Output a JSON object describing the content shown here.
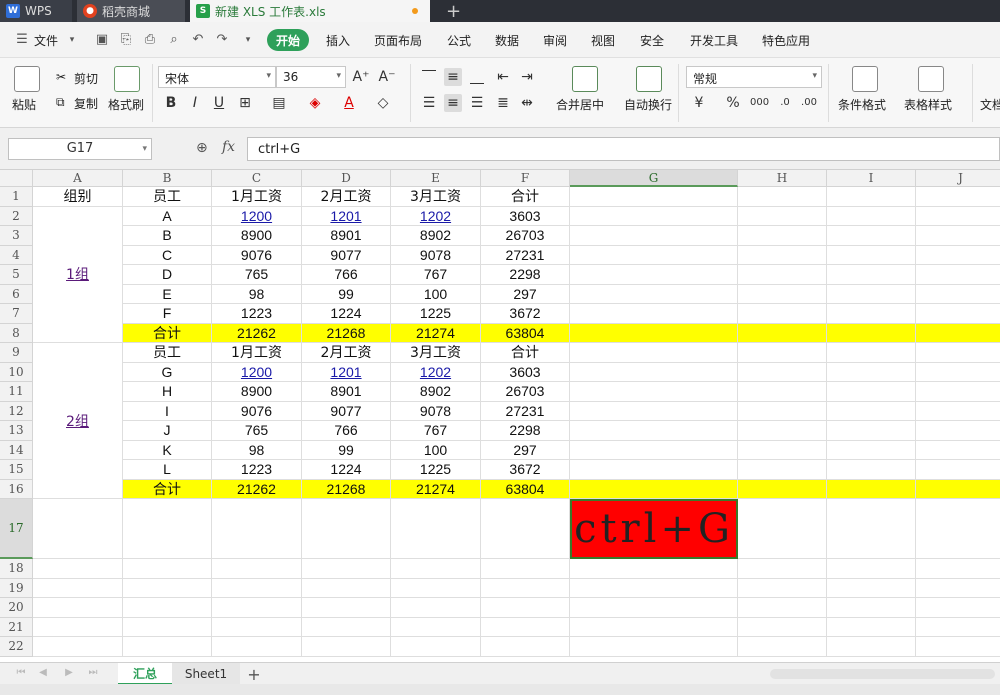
{
  "tabs": {
    "wps": "WPS",
    "daoke": "稻壳商城",
    "file": "新建 XLS 工作表.xls",
    "new": "+"
  },
  "menu": {
    "file": "文件",
    "start": "开始",
    "items": [
      "插入",
      "页面布局",
      "公式",
      "数据",
      "审阅",
      "视图",
      "安全",
      "开发工具",
      "特色应用"
    ]
  },
  "ribbon": {
    "paste": "粘贴",
    "cut": "剪切",
    "copy": "复制",
    "format_painter": "格式刷",
    "font": "宋体",
    "size": "36",
    "merge": "合并居中",
    "wrap": "自动换行",
    "numfmt": "常规",
    "cond": "条件格式",
    "tablestyle": "表格样式",
    "doc": "文档"
  },
  "formula": {
    "namebox": "G17",
    "fx": "fx",
    "value": "ctrl+G"
  },
  "columns": [
    "A",
    "B",
    "C",
    "D",
    "E",
    "F",
    "G",
    "H",
    "I",
    "J"
  ],
  "rows": [
    "1",
    "2",
    "3",
    "4",
    "5",
    "6",
    "7",
    "8",
    "9",
    "10",
    "11",
    "12",
    "13",
    "14",
    "15",
    "16",
    "17",
    "18",
    "19",
    "20",
    "21",
    "22"
  ],
  "table1": {
    "group_header": "组别",
    "headers": [
      "员工",
      "1月工资",
      "2月工资",
      "3月工资",
      "合计"
    ],
    "group": "1组",
    "rows": [
      [
        "A",
        "1200",
        "1201",
        "1202",
        "3603"
      ],
      [
        "B",
        "8900",
        "8901",
        "8902",
        "26703"
      ],
      [
        "C",
        "9076",
        "9077",
        "9078",
        "27231"
      ],
      [
        "D",
        "765",
        "766",
        "767",
        "2298"
      ],
      [
        "E",
        "98",
        "99",
        "100",
        "297"
      ],
      [
        "F",
        "1223",
        "1224",
        "1225",
        "3672"
      ]
    ],
    "total": [
      "合计",
      "21262",
      "21268",
      "21274",
      "63804"
    ]
  },
  "table2": {
    "headers": [
      "员工",
      "1月工资",
      "2月工资",
      "3月工资",
      "合计"
    ],
    "group": "2组",
    "rows": [
      [
        "G",
        "1200",
        "1201",
        "1202",
        "3603"
      ],
      [
        "H",
        "8900",
        "8901",
        "8902",
        "26703"
      ],
      [
        "I",
        "9076",
        "9077",
        "9078",
        "27231"
      ],
      [
        "J",
        "765",
        "766",
        "767",
        "2298"
      ],
      [
        "K",
        "98",
        "99",
        "100",
        "297"
      ],
      [
        "L",
        "1223",
        "1224",
        "1225",
        "3672"
      ]
    ],
    "total": [
      "合计",
      "21262",
      "21268",
      "21274",
      "63804"
    ]
  },
  "g17": "ctrl+G",
  "sheets": {
    "active": "汇总",
    "other": "Sheet1",
    "add": "+"
  },
  "colors": {
    "accent": "#2ea05a",
    "highlight": "#ffff00",
    "red_cell": "#ff0000"
  }
}
